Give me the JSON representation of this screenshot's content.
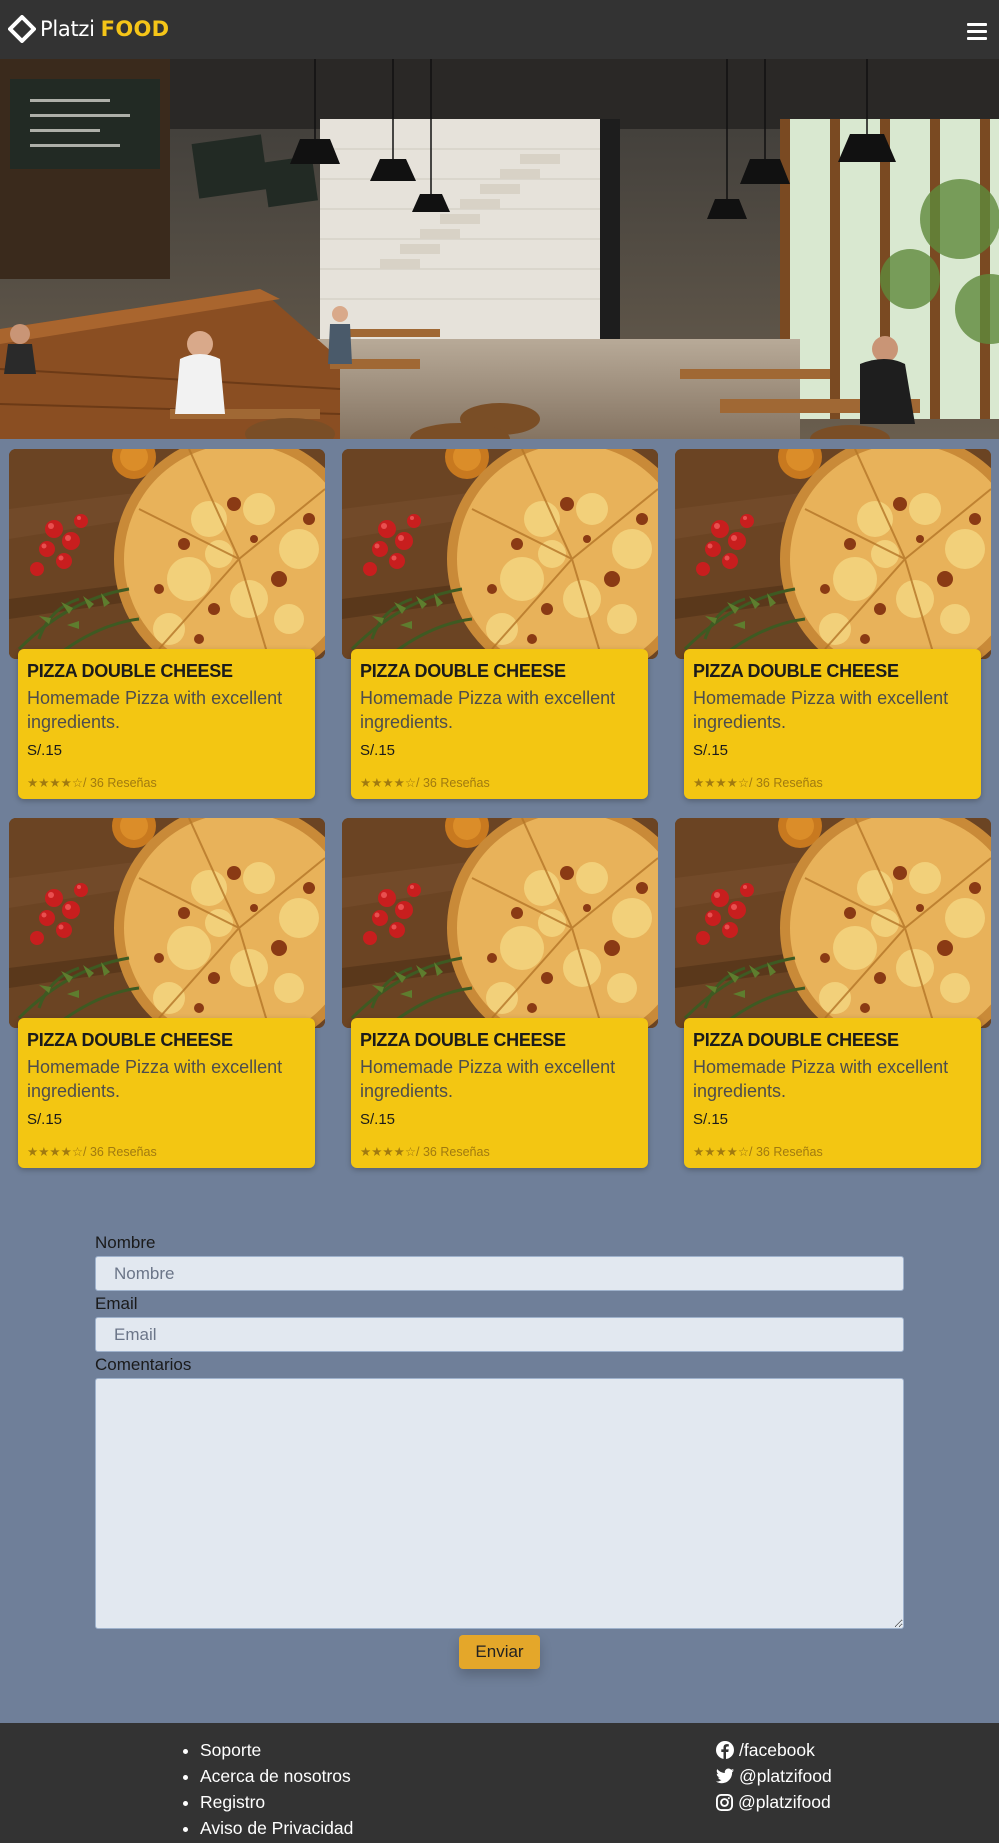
{
  "header": {
    "logo_primary": "Platzi",
    "logo_secondary": "FOOD",
    "menu_icon": "hamburger-menu-icon"
  },
  "hero": {
    "image": "restaurant-interior-photo"
  },
  "products": [
    {
      "title": "PIZZA DOUBLE CHEESE",
      "description": "Homemade Pizza with excellent ingredients.",
      "price": "S/.15",
      "reviews": "★★★★☆/ 36 Reseñas",
      "rating": 4
    },
    {
      "title": "PIZZA DOUBLE CHEESE",
      "description": "Homemade Pizza with excellent ingredients.",
      "price": "S/.15",
      "reviews": "★★★★☆/ 36 Reseñas",
      "rating": 4
    },
    {
      "title": "PIZZA DOUBLE CHEESE",
      "description": "Homemade Pizza with excellent ingredients.",
      "price": "S/.15",
      "reviews": "★★★★☆/ 36 Reseñas",
      "rating": 4
    },
    {
      "title": "PIZZA DOUBLE CHEESE",
      "description": "Homemade Pizza with excellent ingredients.",
      "price": "S/.15",
      "reviews": "★★★★☆/ 36 Reseñas",
      "rating": 4
    },
    {
      "title": "PIZZA DOUBLE CHEESE",
      "description": "Homemade Pizza with excellent ingredients.",
      "price": "S/.15",
      "reviews": "★★★★☆/ 36 Reseñas",
      "rating": 4
    },
    {
      "title": "PIZZA DOUBLE CHEESE",
      "description": "Homemade Pizza with excellent ingredients.",
      "price": "S/.15",
      "reviews": "★★★★☆/ 36 Reseñas",
      "rating": 4
    }
  ],
  "form": {
    "name_label": "Nombre",
    "name_placeholder": "Nombre",
    "name_value": "",
    "email_label": "Email",
    "email_placeholder": "Email",
    "email_value": "",
    "comments_label": "Comentarios",
    "comments_value": "",
    "submit_label": "Enviar"
  },
  "footer": {
    "links": [
      "Soporte",
      "Acerca de nosotros",
      "Registro",
      "Aviso de Privacidad"
    ],
    "social": [
      {
        "icon": "facebook-icon",
        "label": "/facebook"
      },
      {
        "icon": "twitter-icon",
        "label": "@platzifood"
      },
      {
        "icon": "instagram-icon",
        "label": "@platzifood"
      }
    ]
  },
  "colors": {
    "header_bg": "#333333",
    "page_bg": "#6f7f99",
    "card_bg": "#f3c612",
    "brand_yellow": "#f5c518",
    "button_bg": "#e4a72a"
  }
}
